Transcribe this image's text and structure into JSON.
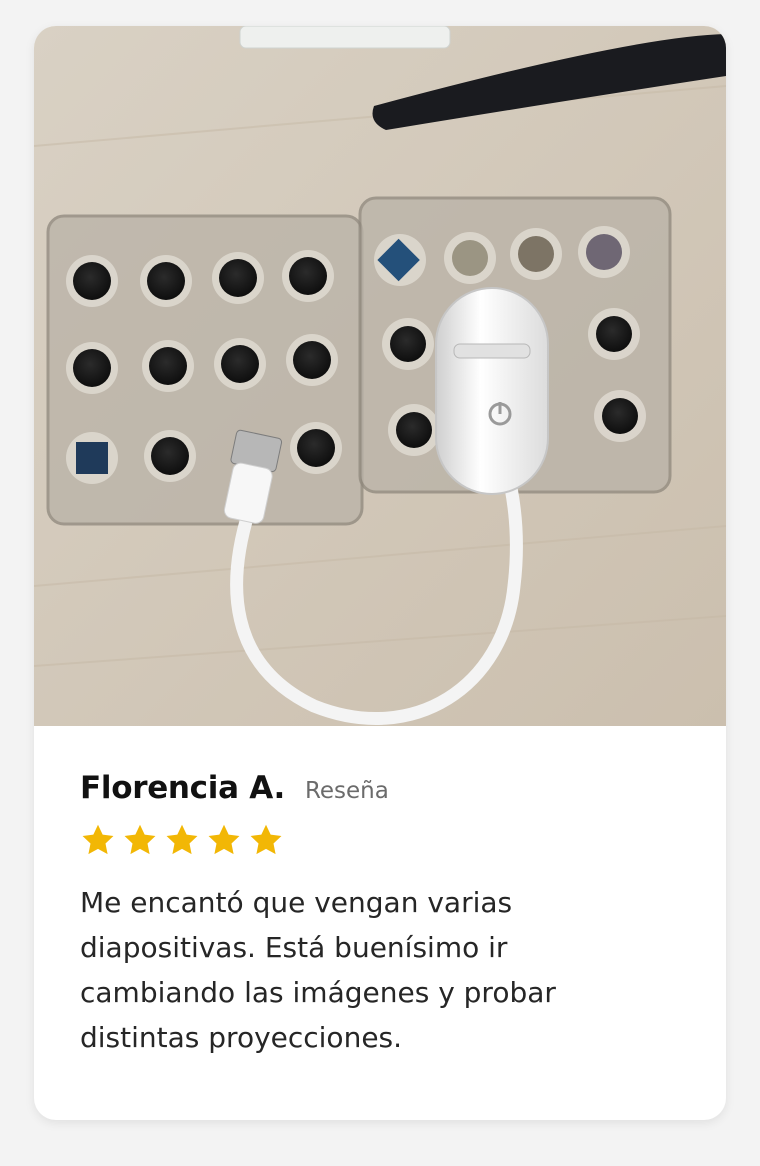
{
  "review": {
    "author": "Florencia A.",
    "badge": "Reseña",
    "rating": 5,
    "rating_max": 5,
    "star_color": "#f2b705",
    "text": "Me encantó que vengan varias\ndiapositivas. Está buenísimo ir\ncambiando las imágenes y probar\ndistintas proyecciones."
  },
  "photo": {
    "subject": "slide-trays-and-usb-projector"
  }
}
